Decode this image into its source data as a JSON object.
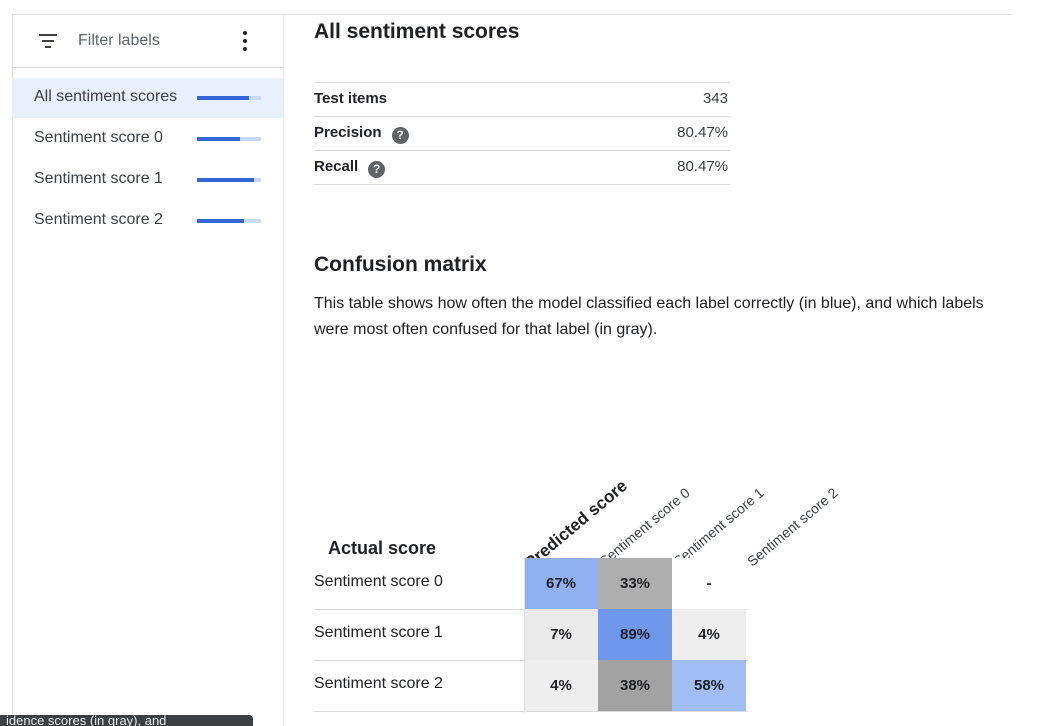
{
  "sidebar": {
    "filter_label": "Filter labels",
    "items": [
      {
        "label": "All sentiment scores",
        "precision": 0.8047,
        "selected": true
      },
      {
        "label": "Sentiment score 0",
        "precision": 0.67
      },
      {
        "label": "Sentiment score 1",
        "precision": 0.89
      },
      {
        "label": "Sentiment score 2",
        "precision": 0.74
      }
    ]
  },
  "summary": {
    "title": "All sentiment scores",
    "metrics": [
      {
        "name": "Test items",
        "value": "343",
        "help": false
      },
      {
        "name": "Precision",
        "value": "80.47%",
        "help": true
      },
      {
        "name": "Recall",
        "value": "80.47%",
        "help": true
      }
    ]
  },
  "confusion": {
    "title": "Confusion matrix",
    "description": "This table shows how often the model classified each label correctly (in blue), and which labels were most often confused for that label (in gray).",
    "predicted_header": "Predicted score",
    "actual_header": "Actual score",
    "columns": [
      "Sentiment score 0",
      "Sentiment score 1",
      "Sentiment score 2"
    ],
    "rows": [
      {
        "label": "Sentiment score 0",
        "cells": [
          {
            "value": "67%",
            "color": "#8fb1f2"
          },
          {
            "value": "33%",
            "color": "#aeaeae"
          },
          {
            "value": "-",
            "color": "#ffffff"
          }
        ]
      },
      {
        "label": "Sentiment score 1",
        "cells": [
          {
            "value": "7%",
            "color": "#eaeaea"
          },
          {
            "value": "89%",
            "color": "#6f97ec"
          },
          {
            "value": "4%",
            "color": "#eeeeee"
          }
        ]
      },
      {
        "label": "Sentiment score 2",
        "cells": [
          {
            "value": "4%",
            "color": "#eeeeee"
          },
          {
            "value": "38%",
            "color": "#a2a2a2"
          },
          {
            "value": "58%",
            "color": "#a0bdf4"
          }
        ]
      }
    ]
  },
  "tooltip": {
    "text": "idence scores (in gray), and"
  }
}
